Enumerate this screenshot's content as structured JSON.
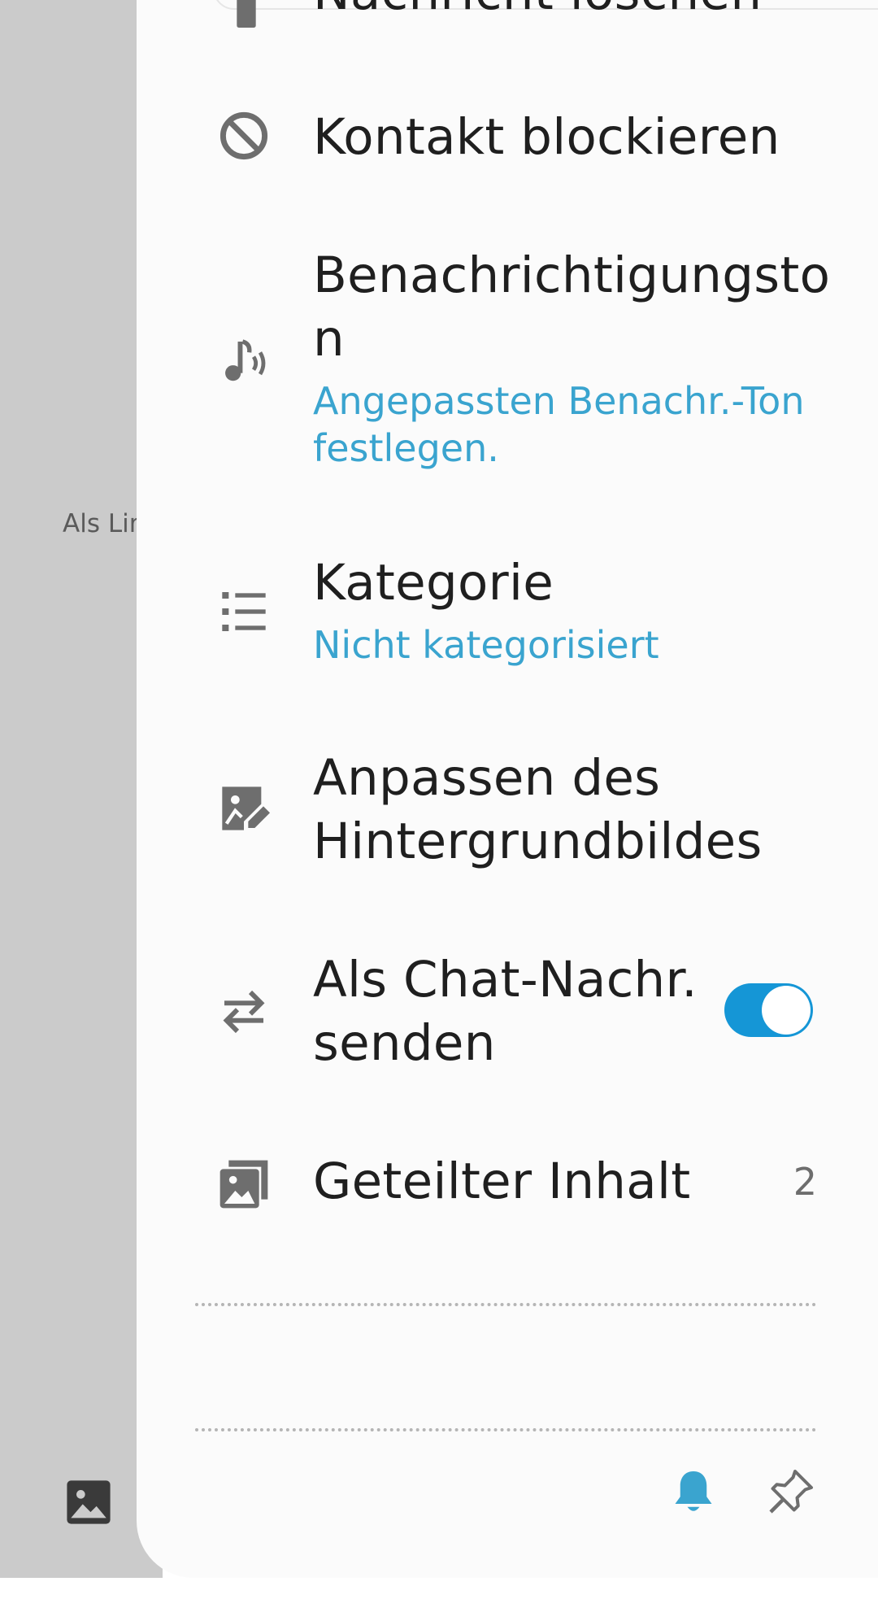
{
  "backdrop": {
    "label": "Als Lin"
  },
  "menu": {
    "delete_message": "Nachricht löschen",
    "block_contact": "Kontakt blockieren",
    "notification_tone_line1": "Benachrichtigungsto",
    "notification_tone_line2": "n",
    "notification_tone_sub_line1": "Angepassten Benachr.-Ton",
    "notification_tone_sub_line2": "festlegen.",
    "category": "Kategorie",
    "category_sub": "Nicht kategorisiert",
    "wallpaper_line1": "Anpassen des",
    "wallpaper_line2": "Hintergrundbildes",
    "chat_send_line1": "Als Chat-Nachr.",
    "chat_send_line2": "senden",
    "chat_send_enabled": true,
    "shared_content": "Geteilter Inhalt",
    "shared_count": "2"
  },
  "colors": {
    "accent": "#3aa4cf",
    "toggle_on": "#1596d6",
    "text": "#1f1f1f",
    "icon": "#6e6e6e"
  },
  "icons": {
    "delete": "trash-icon",
    "block": "block-icon",
    "tone": "music-note-icon",
    "category": "list-icon",
    "wallpaper": "image-edit-icon",
    "chat_send": "swap-arrows-icon",
    "shared": "gallery-icon",
    "bell": "bell-icon",
    "pin": "pin-icon"
  }
}
